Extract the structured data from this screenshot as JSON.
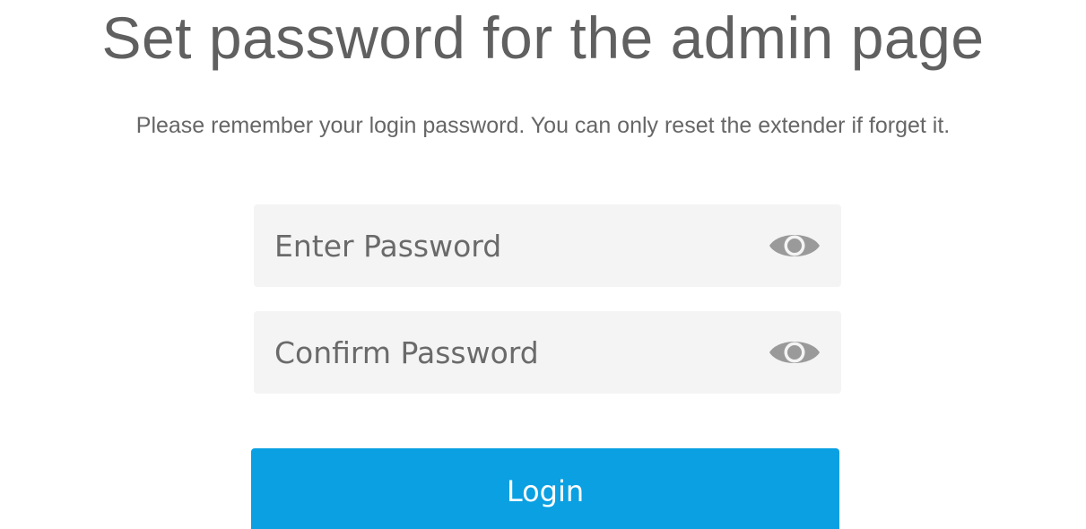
{
  "page": {
    "title": "Set password for the admin page",
    "subtitle": "Please remember your login password. You can only reset the extender if forget it."
  },
  "form": {
    "password": {
      "placeholder": "Enter Password",
      "value": "",
      "icon": "eye-icon"
    },
    "confirm_password": {
      "placeholder": "Confirm Password",
      "value": "",
      "icon": "eye-icon"
    },
    "login_label": "Login"
  },
  "colors": {
    "accent": "#0aa0e2",
    "field_bg": "#f4f4f4",
    "text": "#606060"
  }
}
